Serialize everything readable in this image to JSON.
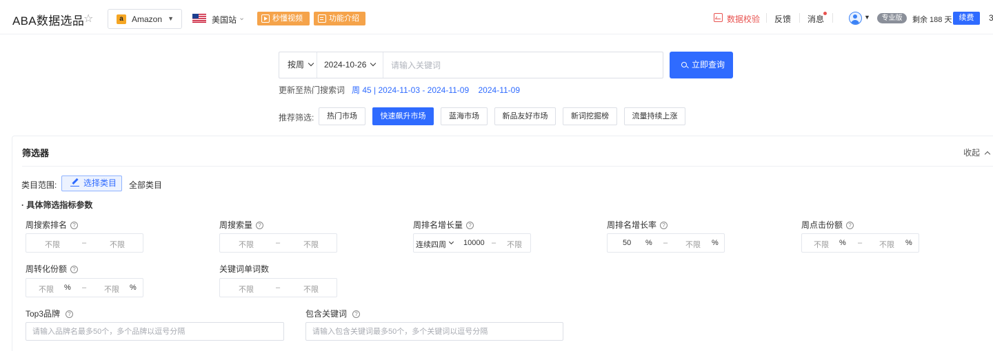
{
  "header": {
    "app_title": "ABA数据选品",
    "marketplace": "Amazon",
    "site": "美国站",
    "video_btn": "秒懂视频",
    "intro_btn": "功能介绍",
    "verify": "数据校验",
    "feedback": "反馈",
    "messages": "消息",
    "plan_badge": "专业版",
    "remaining": "剩余 188 天",
    "renew": "续费",
    "edge_char": "3"
  },
  "search": {
    "period": "按周",
    "date": "2024-10-26",
    "keyword_placeholder": "请输入关键词",
    "query_button": "立即查询",
    "update_prefix": "更新至热门搜索词",
    "update_week": "周 45 | 2024-11-03 - 2024-11-09",
    "update_date": "2024-11-09"
  },
  "recommend": {
    "label": "推荐筛选:",
    "options": [
      "热门市场",
      "快速飙升市场",
      "蓝海市场",
      "新品友好市场",
      "新词挖掘榜",
      "流量持续上涨"
    ],
    "active_index": 1
  },
  "filter": {
    "title": "筛选器",
    "collapse": "收起",
    "category_label": "类目范围:",
    "select_category": "选择类目",
    "all_category": "全部类目",
    "section_title": "· 具体筛选指标参数",
    "fields": {
      "weekly_search_rank": {
        "label": "周搜索排名",
        "min": "不限",
        "max": "不限"
      },
      "weekly_search_volume": {
        "label": "周搜索量",
        "min": "不限",
        "max": "不限"
      },
      "weekly_rank_growth": {
        "label": "周排名增长量",
        "mode": "连续四周",
        "min": "10000",
        "max": "不限"
      },
      "weekly_rank_growth_rate": {
        "label": "周排名增长率",
        "min": "50",
        "max": "不限",
        "unit": "%"
      },
      "weekly_click_share": {
        "label": "周点击份额",
        "min": "不限",
        "max": "不限",
        "unit": "%"
      },
      "weekly_conversion_share": {
        "label": "周转化份额",
        "min": "不限",
        "max": "不限",
        "unit": "%"
      },
      "keyword_word_count": {
        "label": "关键词单词数",
        "min": "不限",
        "max": "不限"
      },
      "top3_brand": {
        "label": "Top3品牌",
        "placeholder": "请输入品牌名最多50个，多个品牌以逗号分隔"
      },
      "include_keywords": {
        "label": "包含关键词",
        "placeholder": "请输入包含关键词最多50个，多个关键词以逗号分隔"
      }
    },
    "dash": "–",
    "help": "?"
  },
  "colors": {
    "primary": "#2f6bff",
    "orange": "#f5a34a",
    "verify_red": "#e8524f"
  }
}
